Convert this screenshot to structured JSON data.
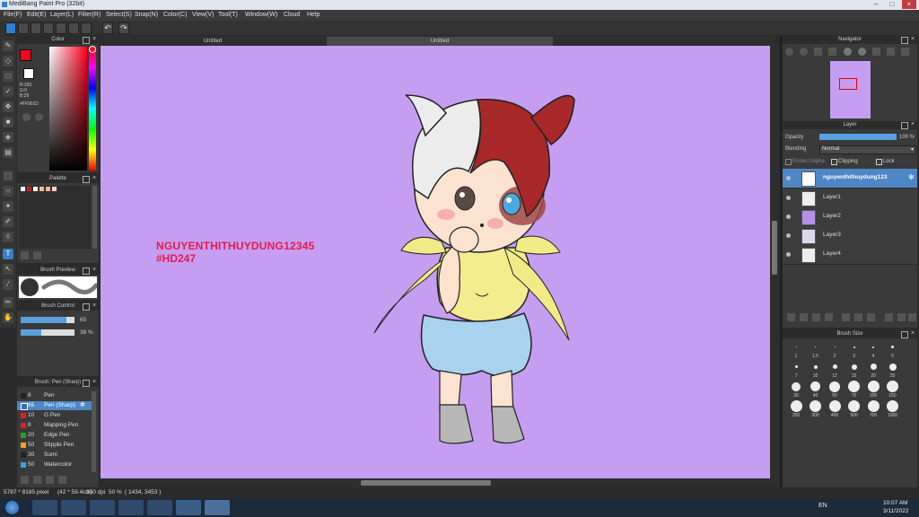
{
  "app": {
    "title": "MediBang Paint Pro (32bit)"
  },
  "menu": [
    "File(F)",
    "Edit(E)",
    "Layer(L)",
    "Filter(R)",
    "Select(S)",
    "Snap(N)",
    "Color(C)",
    "View(V)",
    "Tool(T)",
    "Window(W)",
    "Cloud",
    "Help"
  ],
  "tabs": [
    "Untitled",
    "Untitled"
  ],
  "color_panel": {
    "title": "Color",
    "r": "R:255",
    "g": "G:0",
    "b": "B:29",
    "hex": "#FF001D",
    "primary": "#ff001d"
  },
  "palette_panel": {
    "title": "Palette",
    "swatches": [
      "#ffffff",
      "#d01818",
      "#ffffff",
      "#f0c08a",
      "#ffb0a0",
      "#ffd0c0"
    ]
  },
  "brush_preview": {
    "title": "Brush Preview"
  },
  "brush_control": {
    "title": "Brush Control",
    "size": "65",
    "opacity": "38 %"
  },
  "brush_list": {
    "title": "Brush: Pen (Sharp)",
    "items": [
      {
        "size": "8",
        "name": "Pen",
        "color": "#222222"
      },
      {
        "size": "65",
        "name": "Pen (Sharp)",
        "color": "#3a6fb0"
      },
      {
        "size": "10",
        "name": "G Pen",
        "color": "#e02020"
      },
      {
        "size": "8",
        "name": "Mapping Pen",
        "color": "#e02020"
      },
      {
        "size": "20",
        "name": "Edge Pen",
        "color": "#20a020"
      },
      {
        "size": "50",
        "name": "Stipple Pen",
        "color": "#f0a020"
      },
      {
        "size": "30",
        "name": "Sumi",
        "color": "#222222"
      },
      {
        "size": "50",
        "name": "Watercolor",
        "color": "#40a0e0"
      }
    ]
  },
  "canvas": {
    "watermark_line1": "NGUYENTHITHUYDUNG12345",
    "watermark_line2": "#HD247",
    "bg": "#c59ef2"
  },
  "navigator": {
    "title": "Navigator"
  },
  "layer_panel": {
    "title": "Layer",
    "opacity_label": "Opacity",
    "opacity_value": "100 %",
    "opacity_fraction": 1.0,
    "blending_label": "Blending",
    "blending_value": "Normal",
    "protect_alpha": "Protect Alpha",
    "clipping": "Clipping",
    "lock": "Lock",
    "layers": [
      "nguyenthithuydung123",
      "Layer1",
      "Layer2",
      "Layer3",
      "Layer4"
    ]
  },
  "brush_size": {
    "title": "Brush Size",
    "sizes": [
      "1",
      "1.5",
      "2",
      "3",
      "4",
      "5",
      "7",
      "10",
      "12",
      "15",
      "20",
      "25",
      "30",
      "40",
      "50",
      "70",
      "100",
      "150",
      "200",
      "300",
      "400",
      "500",
      "700",
      "1000"
    ]
  },
  "status": {
    "dimensions": "5787 * 8185 pixel",
    "physical": "(42 * 59.4cm)",
    "dpi": "350 dpi",
    "zoom": "50 %",
    "cursor": "( 1434, 3453 )"
  },
  "taskbar": {
    "lang": "EN",
    "time": "10:07 AM",
    "date": "3/11/2022"
  }
}
